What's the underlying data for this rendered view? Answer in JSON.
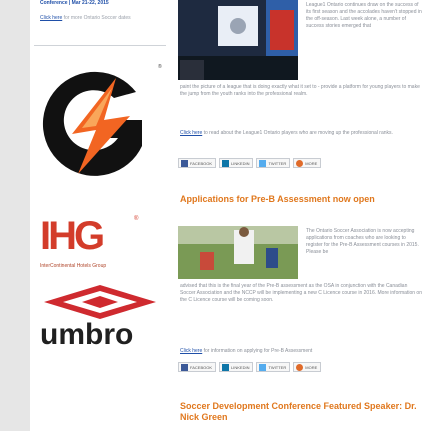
{
  "sidebar": {
    "top_text": "Conference | Mar 21-22, 2015",
    "blurb_link": "Click here",
    "blurb_rest": "for more Ontario Soccer dates",
    "sponsors": [
      {
        "name": "Gatorade",
        "icon": "gatorade-bolt-logo"
      },
      {
        "name": "IHG",
        "caption": "InterContinental Hotels Group"
      },
      {
        "name": "umbro",
        "wordmark": "umbro"
      }
    ],
    "ihg_wordmark": "IHG",
    "ihg_reg": "®",
    "gat_reg": "®"
  },
  "article1": {
    "right_text": "League1 Ontario continues draw on the success of its first season and the accolades haven't stopped in the off-season. Last week alone, a number of success stories emerged that",
    "body_text": "paint the picture of a league that is doing exactly what it set to - provide a platform for young players to make the jump from the youth ranks into the professional realm.",
    "link": "Click here",
    "link_rest": "to read about the League1 Ontario players who are moving up the professional ranks."
  },
  "share": {
    "facebook": "FACEBOOK",
    "linkedin": "LINKEDIN",
    "twitter": "TWITTER",
    "more": "MORE"
  },
  "article2": {
    "heading": "Applications for Pre-B Assessment now open",
    "right_text": "The Ontario Soccer Association is now accepting applications from coaches who are looking to register for the Pre-B Assessment courses in 2015. Please be",
    "body_text": "advised that this is the final year of the Pre-B assessment as the OSA in conjunction with the Canadian Soccer Association and the NCCP will be implementing a new C Licence course in 2016. More information on the C Licence course will be coming soon.",
    "link": "Click here",
    "link_rest": "for information on applying for Pre-B Assessment"
  },
  "article3": {
    "heading": "Soccer Development Conference Featured Speaker: Dr. Nick Green"
  },
  "colors": {
    "accent_orange": "#e0781e",
    "link_blue": "#1f4fa8",
    "gatorade_orange": "#f26522",
    "ihg_red": "#d33c2a"
  }
}
